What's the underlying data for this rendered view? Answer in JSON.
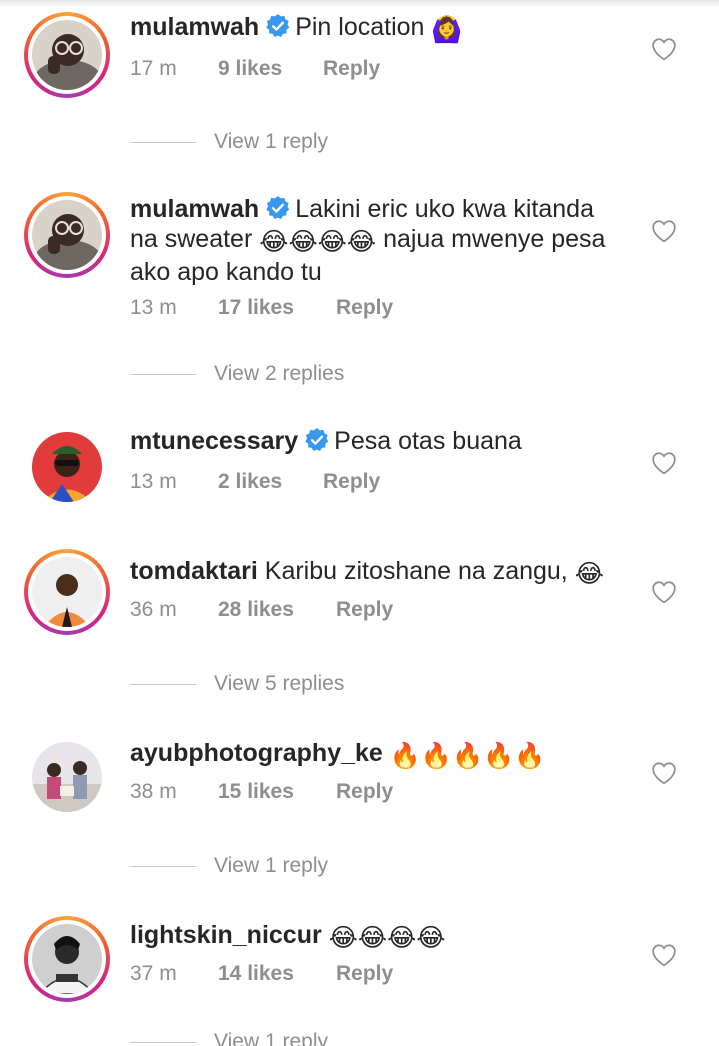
{
  "comments": [
    {
      "username": "mulamwah",
      "verified": true,
      "text": "Pin location",
      "emoji": "🙆‍♀️",
      "time": "17 m",
      "likes": "9 likes",
      "reply": "Reply",
      "view_replies": "View 1 reply"
    },
    {
      "username": "mulamwah",
      "verified": true,
      "text_line1": "Lakini eric uko kwa kitanda",
      "text_line2_a": "na sweater",
      "emoji": "😂😂😂😂",
      "text_line2_b": "najua mwenye pesa",
      "text_line3": "ako apo kando tu",
      "time": "13 m",
      "likes": "17 likes",
      "reply": "Reply",
      "view_replies": "View 2 replies"
    },
    {
      "username": "mtunecessary",
      "verified": true,
      "text": "Pesa otas buana",
      "time": "13 m",
      "likes": "2 likes",
      "reply": "Reply"
    },
    {
      "username": "tomdaktari",
      "verified": false,
      "text": "Karibu zitoshane na zangu,",
      "emoji": "😂",
      "time": "36 m",
      "likes": "28 likes",
      "reply": "Reply",
      "view_replies": "View 5 replies"
    },
    {
      "username": "ayubphotography_ke",
      "verified": false,
      "emoji": "🔥🔥🔥🔥🔥",
      "time": "38 m",
      "likes": "15 likes",
      "reply": "Reply",
      "view_replies": "View 1 reply"
    },
    {
      "username": "lightskin_niccur",
      "verified": false,
      "emoji": "😂😂😂😂",
      "time": "37 m",
      "likes": "14 likes",
      "reply": "Reply",
      "view_replies": "View 1 reply"
    }
  ],
  "colors": {
    "text": "#262626",
    "muted": "#8e8e8e",
    "verified": "#3897f0"
  },
  "icons": {
    "verified": "verified-badge-icon",
    "like": "heart-outline-icon"
  }
}
